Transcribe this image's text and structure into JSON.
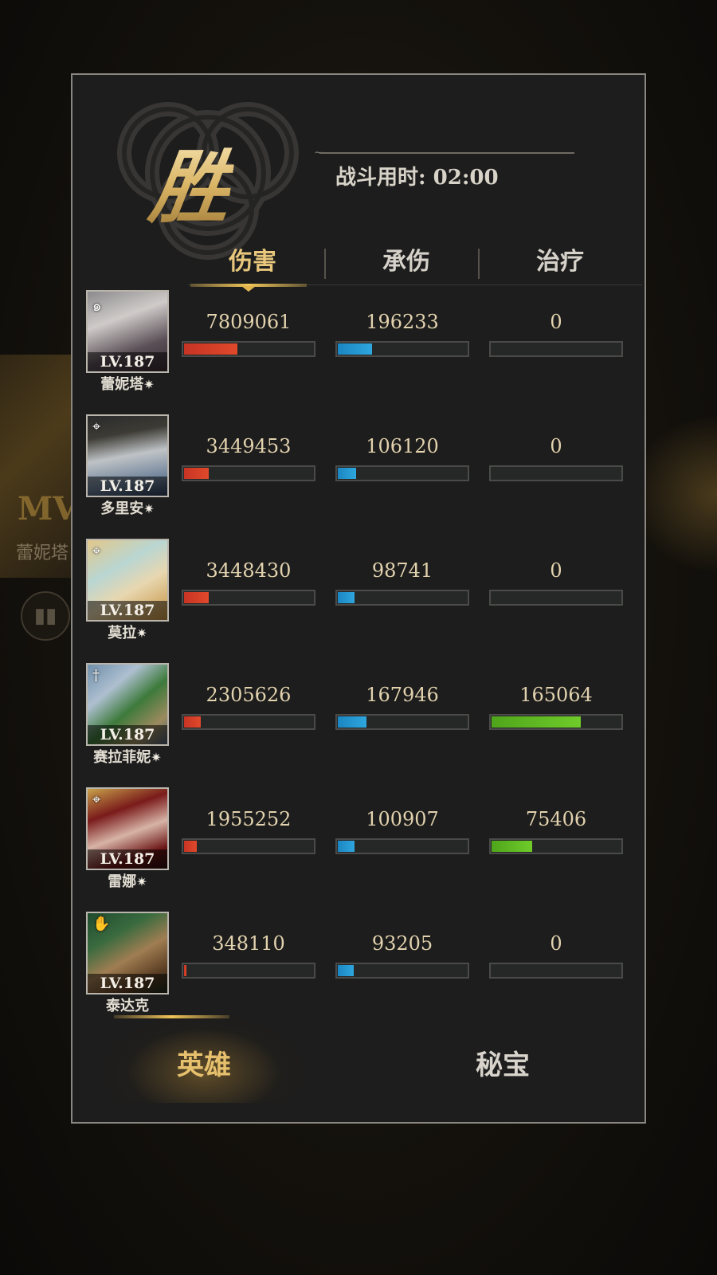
{
  "background": {
    "mvp_text": "MV",
    "mvp_name": "蕾妮塔"
  },
  "header": {
    "result_char": "胜",
    "battle_time": "战斗用时: 02:00"
  },
  "tabs": [
    {
      "label": "伤害",
      "active": true
    },
    {
      "label": "承伤",
      "active": false
    },
    {
      "label": "治疗",
      "active": false
    }
  ],
  "heroes": [
    {
      "name": "蕾妮塔",
      "starred": true,
      "level": "LV.187",
      "class_icon": "spiral-icon",
      "damage": "7809061",
      "damage_pct": 0.41,
      "taken": "196233",
      "taken_pct": 0.26,
      "heal": "0",
      "heal_pct": 0
    },
    {
      "name": "多里安",
      "starred": true,
      "level": "LV.187",
      "class_icon": "bow-icon",
      "damage": "3449453",
      "damage_pct": 0.19,
      "taken": "106120",
      "taken_pct": 0.14,
      "heal": "0",
      "heal_pct": 0
    },
    {
      "name": "莫拉",
      "starred": true,
      "level": "LV.187",
      "class_icon": "bow-icon",
      "damage": "3448430",
      "damage_pct": 0.19,
      "taken": "98741",
      "taken_pct": 0.13,
      "heal": "0",
      "heal_pct": 0
    },
    {
      "name": "赛拉菲妮",
      "starred": true,
      "level": "LV.187",
      "class_icon": "cross-icon",
      "damage": "2305626",
      "damage_pct": 0.13,
      "taken": "167946",
      "taken_pct": 0.22,
      "heal": "165064",
      "heal_pct": 0.68
    },
    {
      "name": "雷娜",
      "starred": true,
      "level": "LV.187",
      "class_icon": "bow-icon",
      "damage": "1955252",
      "damage_pct": 0.1,
      "taken": "100907",
      "taken_pct": 0.13,
      "heal": "75406",
      "heal_pct": 0.31
    },
    {
      "name": "泰达克",
      "starred": false,
      "level": "LV.187",
      "class_icon": "hand-icon",
      "damage": "348110",
      "damage_pct": 0.02,
      "taken": "93205",
      "taken_pct": 0.12,
      "heal": "0",
      "heal_pct": 0
    }
  ],
  "bottom_nav": {
    "heroes_label": "英雄",
    "treasure_label": "秘宝"
  },
  "colors": {
    "damage": "#d93d27",
    "taken": "#2299d2",
    "heal": "#5fbb22",
    "accent_gold": "#e8c77c"
  }
}
